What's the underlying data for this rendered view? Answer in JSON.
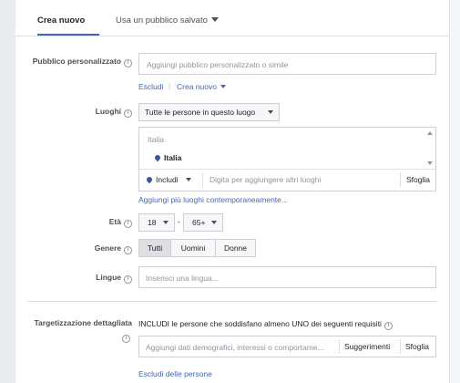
{
  "tabs": {
    "create": "Crea nuovo",
    "saved": "Usa un pubblico salvato"
  },
  "custom_audience": {
    "label": "Pubblico personalizzato",
    "placeholder": "Aggiungi pubblico personalizzato o simile",
    "exclude": "Escludi",
    "separator": "|",
    "create_new": "Crea nuovo"
  },
  "places": {
    "label": "Luoghi",
    "dropdown": "Tutte le persone in questo luogo",
    "country_group": "Italia",
    "selected": "Italia",
    "include": "Includi",
    "input_placeholder": "Digita per aggiungere altri luoghi",
    "browse": "Sfoglia",
    "add_bulk": "Aggiungi più luoghi contemporaneamente..."
  },
  "age": {
    "label": "Età",
    "min": "18",
    "dash": "-",
    "max": "65+"
  },
  "gender": {
    "label": "Genere",
    "options": [
      "Tutti",
      "Uomini",
      "Donne"
    ],
    "selected": "Tutti"
  },
  "languages": {
    "label": "Lingue",
    "placeholder": "Inserisci una lingua..."
  },
  "detailed": {
    "label": "Targetizzazione dettagliata",
    "description": "INCLUDI le persone che soddisfano almeno UNO dei seguenti requisiti",
    "placeholder": "Aggiungi dati demografici, interessi o comportame...",
    "suggestions": "Suggerimenti",
    "browse": "Sfoglia",
    "exclude_people": "Escludi delle persone"
  },
  "icons": {
    "info": "i"
  }
}
